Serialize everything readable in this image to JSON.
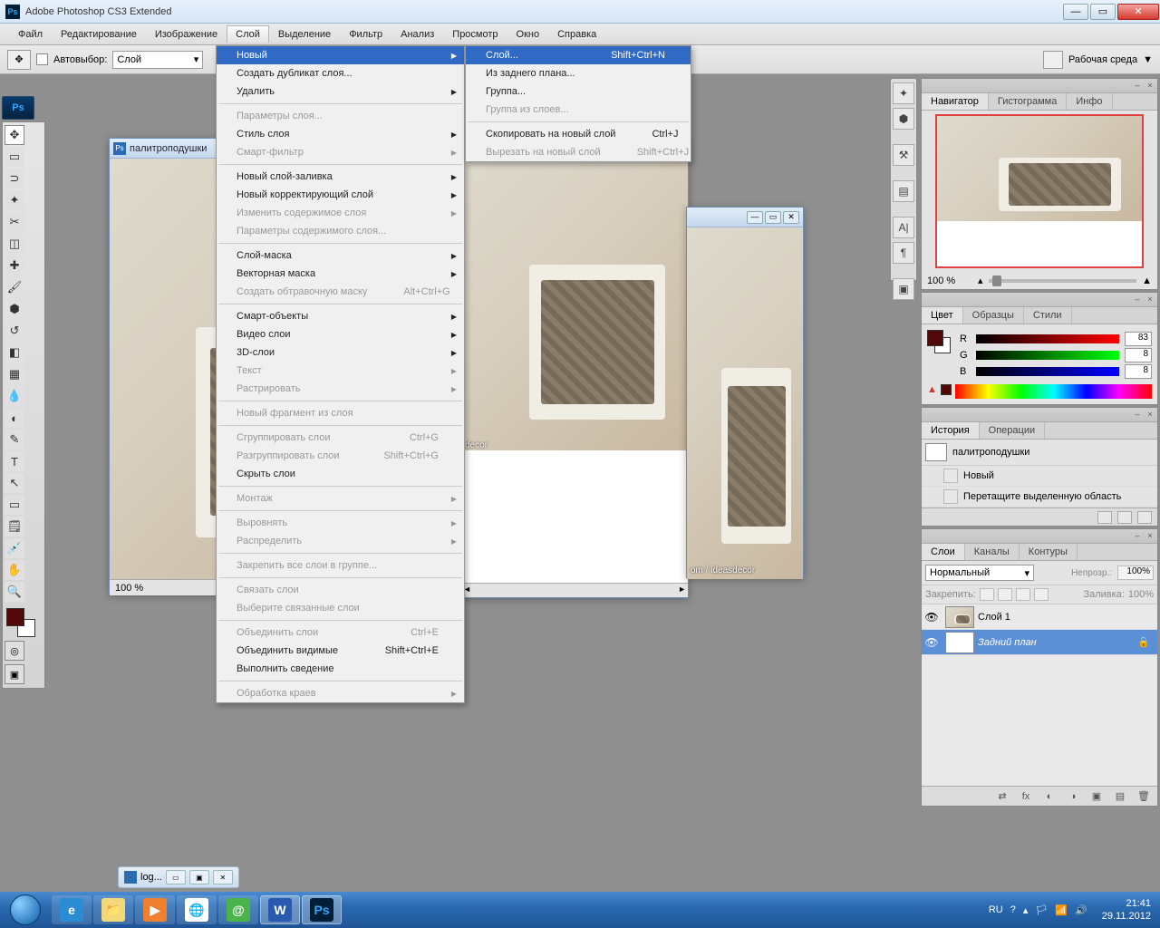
{
  "app": {
    "title": "Adobe Photoshop CS3 Extended"
  },
  "menubar": [
    "Файл",
    "Редактирование",
    "Изображение",
    "Слой",
    "Выделение",
    "Фильтр",
    "Анализ",
    "Просмотр",
    "Окно",
    "Справка"
  ],
  "menubar_active_index": 3,
  "optionsbar": {
    "autoselect_label": "Автовыбор:",
    "autoselect_value": "Слой",
    "workspace_label": "Рабочая среда"
  },
  "dropdown_layer": [
    {
      "type": "item",
      "label": "Новый",
      "arrow": true,
      "sel": true
    },
    {
      "type": "item",
      "label": "Создать дубликат слоя..."
    },
    {
      "type": "item",
      "label": "Удалить",
      "arrow": true
    },
    {
      "type": "sep"
    },
    {
      "type": "item",
      "label": "Параметры слоя...",
      "disabled": true
    },
    {
      "type": "item",
      "label": "Стиль слоя",
      "arrow": true
    },
    {
      "type": "item",
      "label": "Смарт-фильтр",
      "arrow": true,
      "disabled": true
    },
    {
      "type": "sep"
    },
    {
      "type": "item",
      "label": "Новый слой-заливка",
      "arrow": true
    },
    {
      "type": "item",
      "label": "Новый корректирующий слой",
      "arrow": true
    },
    {
      "type": "item",
      "label": "Изменить содержимое слоя",
      "arrow": true,
      "disabled": true
    },
    {
      "type": "item",
      "label": "Параметры содержимого слоя...",
      "disabled": true
    },
    {
      "type": "sep"
    },
    {
      "type": "item",
      "label": "Слой-маска",
      "arrow": true
    },
    {
      "type": "item",
      "label": "Векторная маска",
      "arrow": true
    },
    {
      "type": "item",
      "label": "Создать обтравочную маску",
      "shortcut": "Alt+Ctrl+G",
      "disabled": true
    },
    {
      "type": "sep"
    },
    {
      "type": "item",
      "label": "Смарт-объекты",
      "arrow": true
    },
    {
      "type": "item",
      "label": "Видео слои",
      "arrow": true
    },
    {
      "type": "item",
      "label": "3D-слои",
      "arrow": true
    },
    {
      "type": "item",
      "label": "Текст",
      "arrow": true,
      "disabled": true
    },
    {
      "type": "item",
      "label": "Растрировать",
      "arrow": true,
      "disabled": true
    },
    {
      "type": "sep"
    },
    {
      "type": "item",
      "label": "Новый фрагмент из слоя",
      "disabled": true
    },
    {
      "type": "sep"
    },
    {
      "type": "item",
      "label": "Сгруппировать слои",
      "shortcut": "Ctrl+G",
      "disabled": true
    },
    {
      "type": "item",
      "label": "Разгруппировать слои",
      "shortcut": "Shift+Ctrl+G",
      "disabled": true
    },
    {
      "type": "item",
      "label": "Скрыть слои"
    },
    {
      "type": "sep"
    },
    {
      "type": "item",
      "label": "Монтаж",
      "arrow": true,
      "disabled": true
    },
    {
      "type": "sep"
    },
    {
      "type": "item",
      "label": "Выровнять",
      "arrow": true,
      "disabled": true
    },
    {
      "type": "item",
      "label": "Распределить",
      "arrow": true,
      "disabled": true
    },
    {
      "type": "sep"
    },
    {
      "type": "item",
      "label": "Закрепить все слои в группе...",
      "disabled": true
    },
    {
      "type": "sep"
    },
    {
      "type": "item",
      "label": "Связать слои",
      "disabled": true
    },
    {
      "type": "item",
      "label": "Выберите связанные слои",
      "disabled": true
    },
    {
      "type": "sep"
    },
    {
      "type": "item",
      "label": "Объединить слои",
      "shortcut": "Ctrl+E",
      "disabled": true
    },
    {
      "type": "item",
      "label": "Объединить видимые",
      "shortcut": "Shift+Ctrl+E"
    },
    {
      "type": "item",
      "label": "Выполнить сведение"
    },
    {
      "type": "sep"
    },
    {
      "type": "item",
      "label": "Обработка краев",
      "arrow": true,
      "disabled": true
    }
  ],
  "submenu_new": [
    {
      "label": "Слой...",
      "shortcut": "Shift+Ctrl+N",
      "sel": true
    },
    {
      "label": "Из заднего плана..."
    },
    {
      "label": "Группа..."
    },
    {
      "label": "Группа из слоев...",
      "disabled": true
    },
    {
      "sep": true
    },
    {
      "label": "Скопировать на новый слой",
      "shortcut": "Ctrl+J"
    },
    {
      "label": "Вырезать на новый слой",
      "shortcut": "Shift+Ctrl+J",
      "disabled": true
    }
  ],
  "doc1": {
    "title": "палитроподушки",
    "zoom": "100 %"
  },
  "doc2": {
    "watermark": "decor"
  },
  "doc3": {
    "watermark": "om / ideasdecor"
  },
  "tabbed_doc": {
    "label": "log..."
  },
  "navigator": {
    "tabs": [
      "Навигатор",
      "Гистограмма",
      "Инфо"
    ],
    "active": 0,
    "zoom": "100 %"
  },
  "color": {
    "tabs": [
      "Цвет",
      "Образцы",
      "Стили"
    ],
    "active": 0,
    "r_label": "R",
    "r": "83",
    "g_label": "G",
    "g": "8",
    "b_label": "B",
    "b": "8"
  },
  "history": {
    "tabs": [
      "История",
      "Операции"
    ],
    "active": 0,
    "doc": "палитроподушки",
    "steps": [
      "Новый",
      "Перетащите выделенную область"
    ]
  },
  "layers": {
    "tabs": [
      "Слои",
      "Каналы",
      "Контуры"
    ],
    "active": 0,
    "blend": "Нормальный",
    "opacity_label": "Непрозр.:",
    "opacity": "100%",
    "lock_label": "Закрепить:",
    "fill_label": "Заливка:",
    "fill": "100%",
    "rows": [
      {
        "name": "Слой 1",
        "sel": false
      },
      {
        "name": "Задний план",
        "sel": true,
        "locked": true
      }
    ]
  },
  "tray": {
    "lang": "RU",
    "time": "21:41",
    "date": "29.11.2012"
  }
}
